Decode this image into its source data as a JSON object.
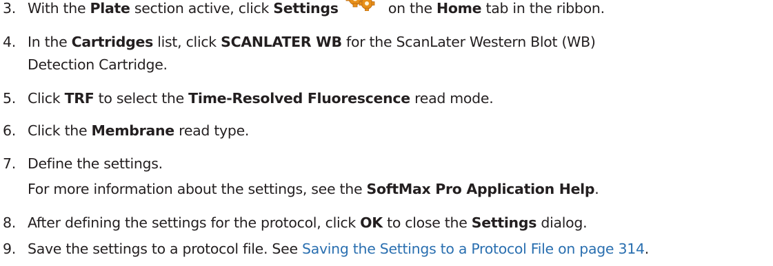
{
  "steps": [
    {
      "num": "3.",
      "parts": [
        {
          "t": "With the "
        },
        {
          "t": "Plate",
          "b": true
        },
        {
          "t": " section active, click "
        },
        {
          "t": "Settings",
          "b": true
        },
        {
          "icon": "settings-gear-icon"
        },
        {
          "t": " on the "
        },
        {
          "t": "Home",
          "b": true
        },
        {
          "t": " tab in the ribbon."
        }
      ]
    },
    {
      "num": "4.",
      "parts": [
        {
          "t": "In the "
        },
        {
          "t": "Cartridges",
          "b": true
        },
        {
          "t": " list, click "
        },
        {
          "t": "SCANLATER WB",
          "b": true
        },
        {
          "t": " for the ScanLater Western Blot (WB)"
        }
      ],
      "line2": [
        {
          "t": "Detection Cartridge."
        }
      ]
    },
    {
      "num": "5.",
      "parts": [
        {
          "t": "Click "
        },
        {
          "t": "TRF",
          "b": true
        },
        {
          "t": " to select the "
        },
        {
          "t": "Time-Resolved Fluorescence",
          "b": true
        },
        {
          "t": " read mode."
        }
      ]
    },
    {
      "num": "6.",
      "parts": [
        {
          "t": "Click the "
        },
        {
          "t": "Membrane",
          "b": true
        },
        {
          "t": " read type."
        }
      ]
    },
    {
      "num": "7.",
      "parts": [
        {
          "t": "Define the settings."
        }
      ],
      "line2": [
        {
          "t": "For more information about the settings, see the "
        },
        {
          "t": "SoftMax Pro Application Help",
          "b": true
        },
        {
          "t": "."
        }
      ]
    },
    {
      "num": "8.",
      "parts": [
        {
          "t": "After defining the settings for the protocol, click "
        },
        {
          "t": "OK",
          "b": true
        },
        {
          "t": " to close the "
        },
        {
          "t": "Settings",
          "b": true
        },
        {
          "t": " dialog."
        }
      ]
    },
    {
      "num": "9.",
      "parts": [
        {
          "t": "Save the settings to a protocol file. See "
        },
        {
          "t": "Saving the Settings to a Protocol File on page 314",
          "link": true
        },
        {
          "t": "."
        }
      ]
    }
  ],
  "colors": {
    "text": "#231f20",
    "link": "#2a6fb0",
    "gear": "#e8901a"
  }
}
